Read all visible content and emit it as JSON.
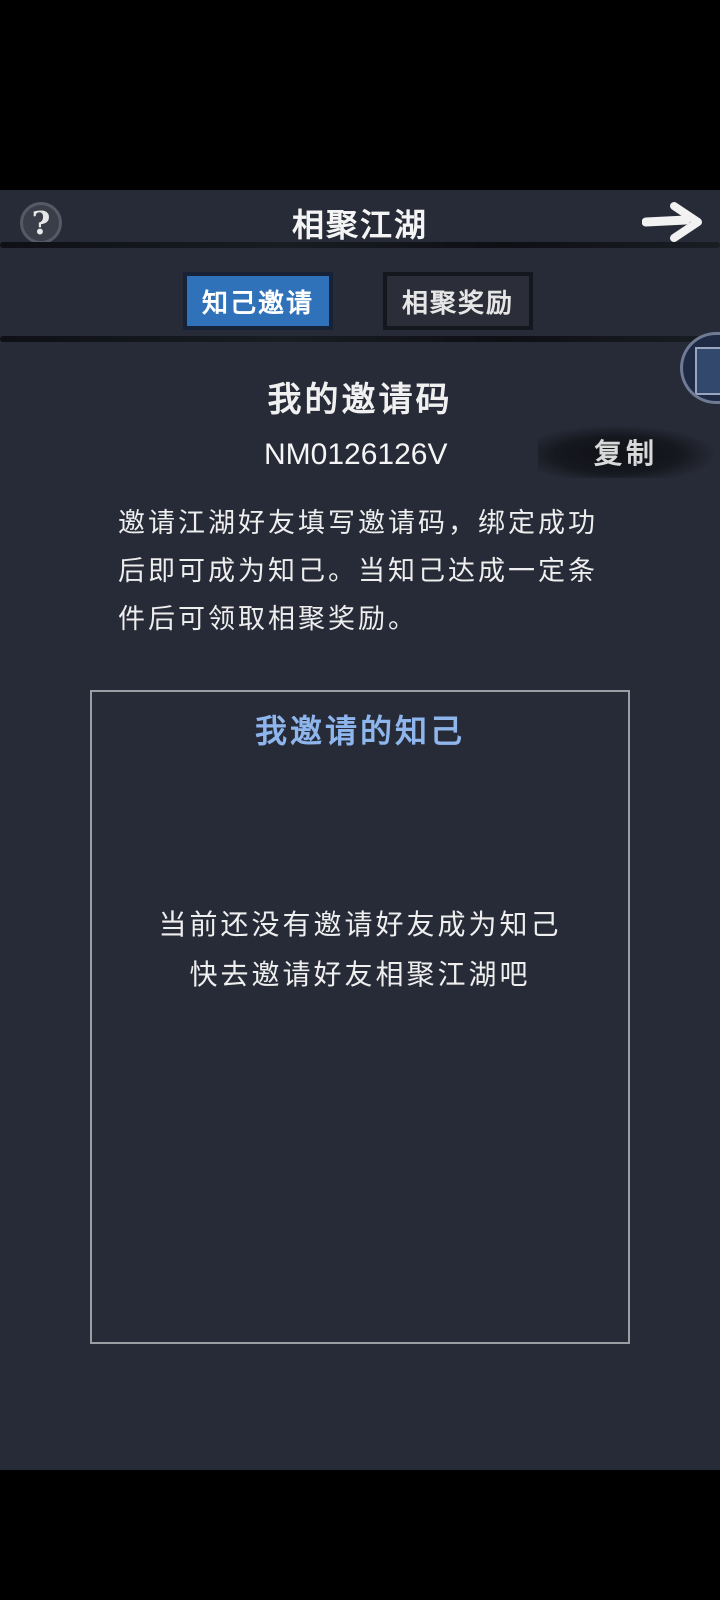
{
  "header": {
    "title": "相聚江湖",
    "help_glyph": "?",
    "back_icon": "arrow-right-icon"
  },
  "tabs": [
    {
      "label": "知己邀请",
      "active": true
    },
    {
      "label": "相聚奖励",
      "active": false
    }
  ],
  "invite": {
    "title": "我的邀请码",
    "code": "NM0126126V",
    "copy_label": "复制",
    "description": "邀请江湖好友填写邀请码，绑定成功后即可成为知己。当知己达成一定条件后可领取相聚奖励。"
  },
  "friends_panel": {
    "title": "我邀请的知己",
    "empty_line1": "当前还没有邀请好友成为知己",
    "empty_line2": "快去邀请好友相聚江湖吧"
  },
  "colors": {
    "background": "#272a37",
    "active_tab": "#2f72b9",
    "panel_title": "#8eb6ec"
  }
}
